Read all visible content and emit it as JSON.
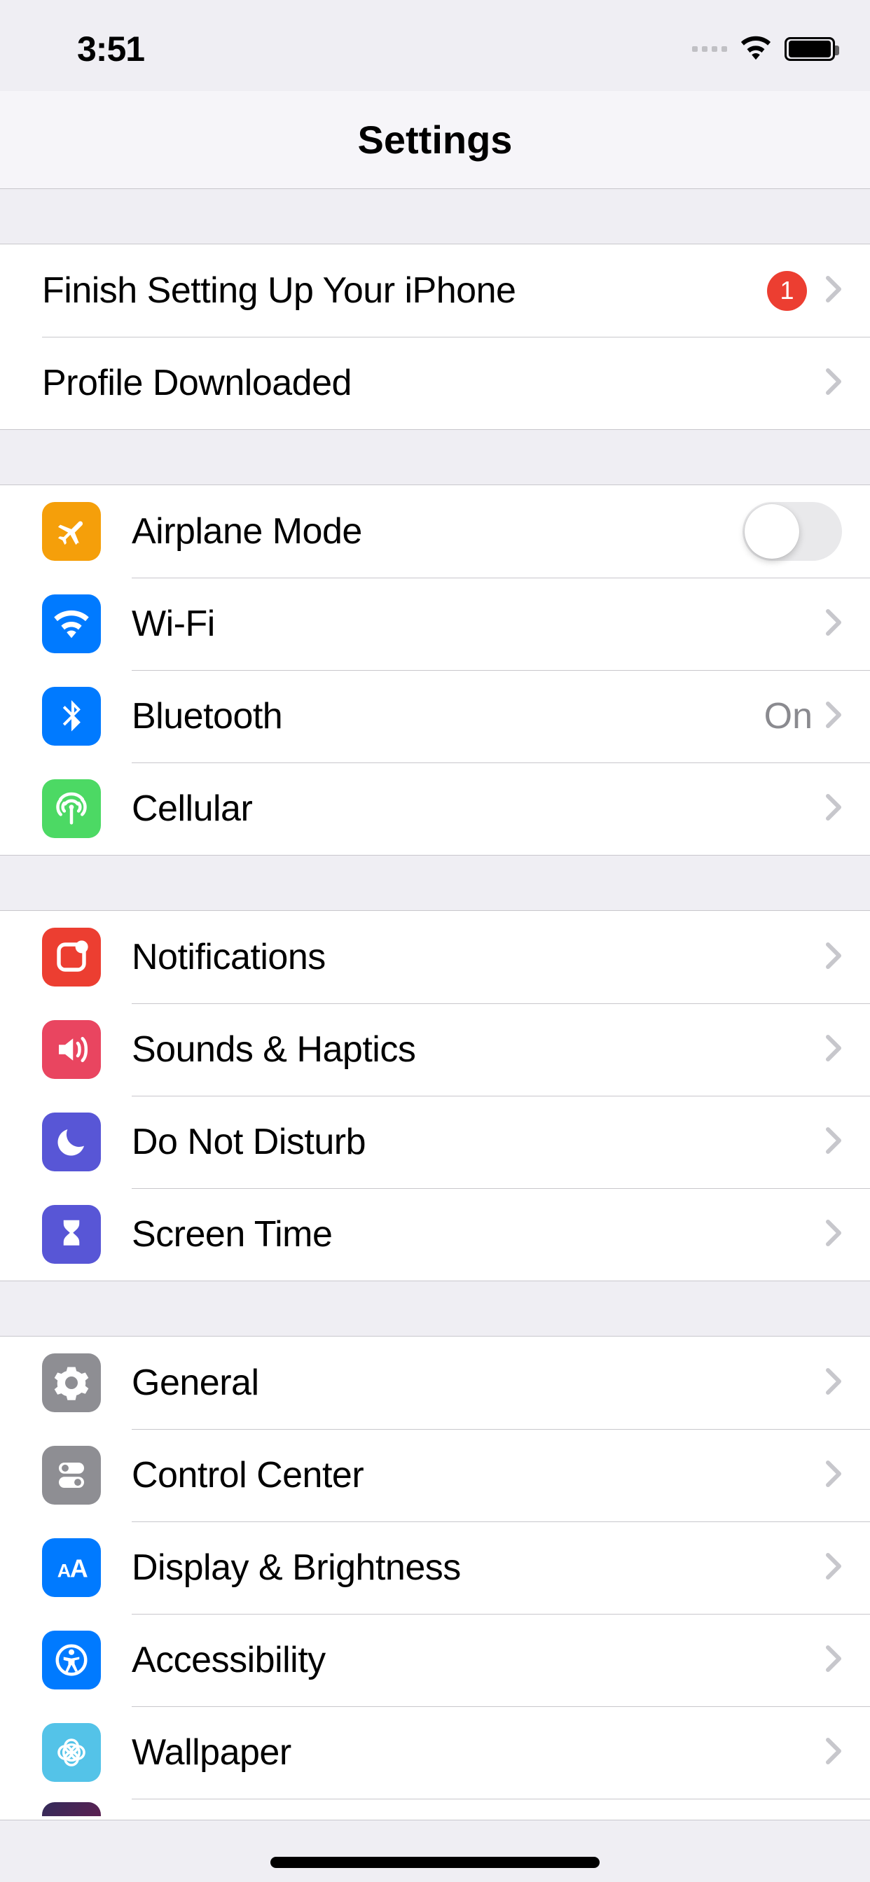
{
  "status": {
    "time": "3:51"
  },
  "nav": {
    "title": "Settings"
  },
  "group0": {
    "setup": {
      "label": "Finish Setting Up Your iPhone",
      "badge": "1"
    },
    "profile": {
      "label": "Profile Downloaded"
    }
  },
  "group1": {
    "airplane": {
      "label": "Airplane Mode",
      "on": false
    },
    "wifi": {
      "label": "Wi-Fi",
      "value": ""
    },
    "bluetooth": {
      "label": "Bluetooth",
      "value": "On"
    },
    "cellular": {
      "label": "Cellular"
    }
  },
  "group2": {
    "notifications": {
      "label": "Notifications"
    },
    "sounds": {
      "label": "Sounds & Haptics"
    },
    "dnd": {
      "label": "Do Not Disturb"
    },
    "screentime": {
      "label": "Screen Time"
    }
  },
  "group3": {
    "general": {
      "label": "General"
    },
    "controlcenter": {
      "label": "Control Center"
    },
    "display": {
      "label": "Display & Brightness"
    },
    "accessibility": {
      "label": "Accessibility"
    },
    "wallpaper": {
      "label": "Wallpaper"
    }
  }
}
